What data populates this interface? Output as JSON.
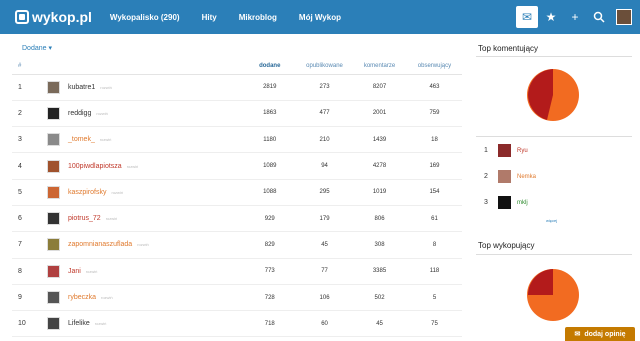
{
  "logo": "wykop.pl",
  "nav": [
    "Wykopalisko (290)",
    "Hity",
    "Mikroblog",
    "Mój Wykop"
  ],
  "filter_label": "Dodane ▾",
  "table": {
    "headers": [
      "#",
      "dodane",
      "opublikowane",
      "komentarze",
      "obserwujący"
    ],
    "row_link": "rozwiń",
    "rows": [
      {
        "rank": "1",
        "user": "kubatre1",
        "dodane": "2819",
        "opublikowane": "273",
        "komentarze": "8207",
        "obserwujacy": "463",
        "color": "#333333"
      },
      {
        "rank": "2",
        "user": "reddigg",
        "dodane": "1863",
        "opublikowane": "477",
        "komentarze": "2001",
        "obserwujacy": "759",
        "color": "#333333"
      },
      {
        "rank": "3",
        "user": "_tomek_",
        "dodane": "1180",
        "opublikowane": "210",
        "komentarze": "1439",
        "obserwujacy": "18",
        "color": "#e07a2e"
      },
      {
        "rank": "4",
        "user": "100piwdlapiotsza",
        "dodane": "1089",
        "opublikowane": "94",
        "komentarze": "4278",
        "obserwujacy": "169",
        "color": "#c0392b"
      },
      {
        "rank": "5",
        "user": "kaszpirofsky",
        "dodane": "1088",
        "opublikowane": "295",
        "komentarze": "1019",
        "obserwujacy": "154",
        "color": "#e07a2e"
      },
      {
        "rank": "6",
        "user": "piotrus_72",
        "dodane": "929",
        "opublikowane": "179",
        "komentarze": "806",
        "obserwujacy": "61",
        "color": "#c0392b"
      },
      {
        "rank": "7",
        "user": "zapomnianaszuflada",
        "dodane": "829",
        "opublikowane": "45",
        "komentarze": "308",
        "obserwujacy": "8",
        "color": "#e07a2e"
      },
      {
        "rank": "8",
        "user": "Jani",
        "dodane": "773",
        "opublikowane": "77",
        "komentarze": "3385",
        "obserwujacy": "118",
        "color": "#c0392b"
      },
      {
        "rank": "9",
        "user": "rybeczka",
        "dodane": "728",
        "opublikowane": "106",
        "komentarze": "502",
        "obserwujacy": "5",
        "color": "#e07a2e"
      },
      {
        "rank": "10",
        "user": "Lifelike",
        "dodane": "718",
        "opublikowane": "60",
        "komentarze": "45",
        "obserwujacy": "75",
        "color": "#333333"
      }
    ]
  },
  "top_comment": {
    "title": "Top komentujący",
    "users": [
      {
        "rank": "1",
        "name": "Ryu",
        "color": "#c0392b"
      },
      {
        "rank": "2",
        "name": "Nemka",
        "color": "#e07a2e"
      },
      {
        "rank": "3",
        "name": "mklj",
        "color": "#2e8b2e"
      }
    ],
    "more": "więcej"
  },
  "top_digg": {
    "title": "Top wykopujący"
  },
  "feedback": "dodaj opinię",
  "colors": {
    "brand": "#2b7fb8",
    "pie_dark": "#b31b1b",
    "pie_orange": "#f26b21"
  }
}
